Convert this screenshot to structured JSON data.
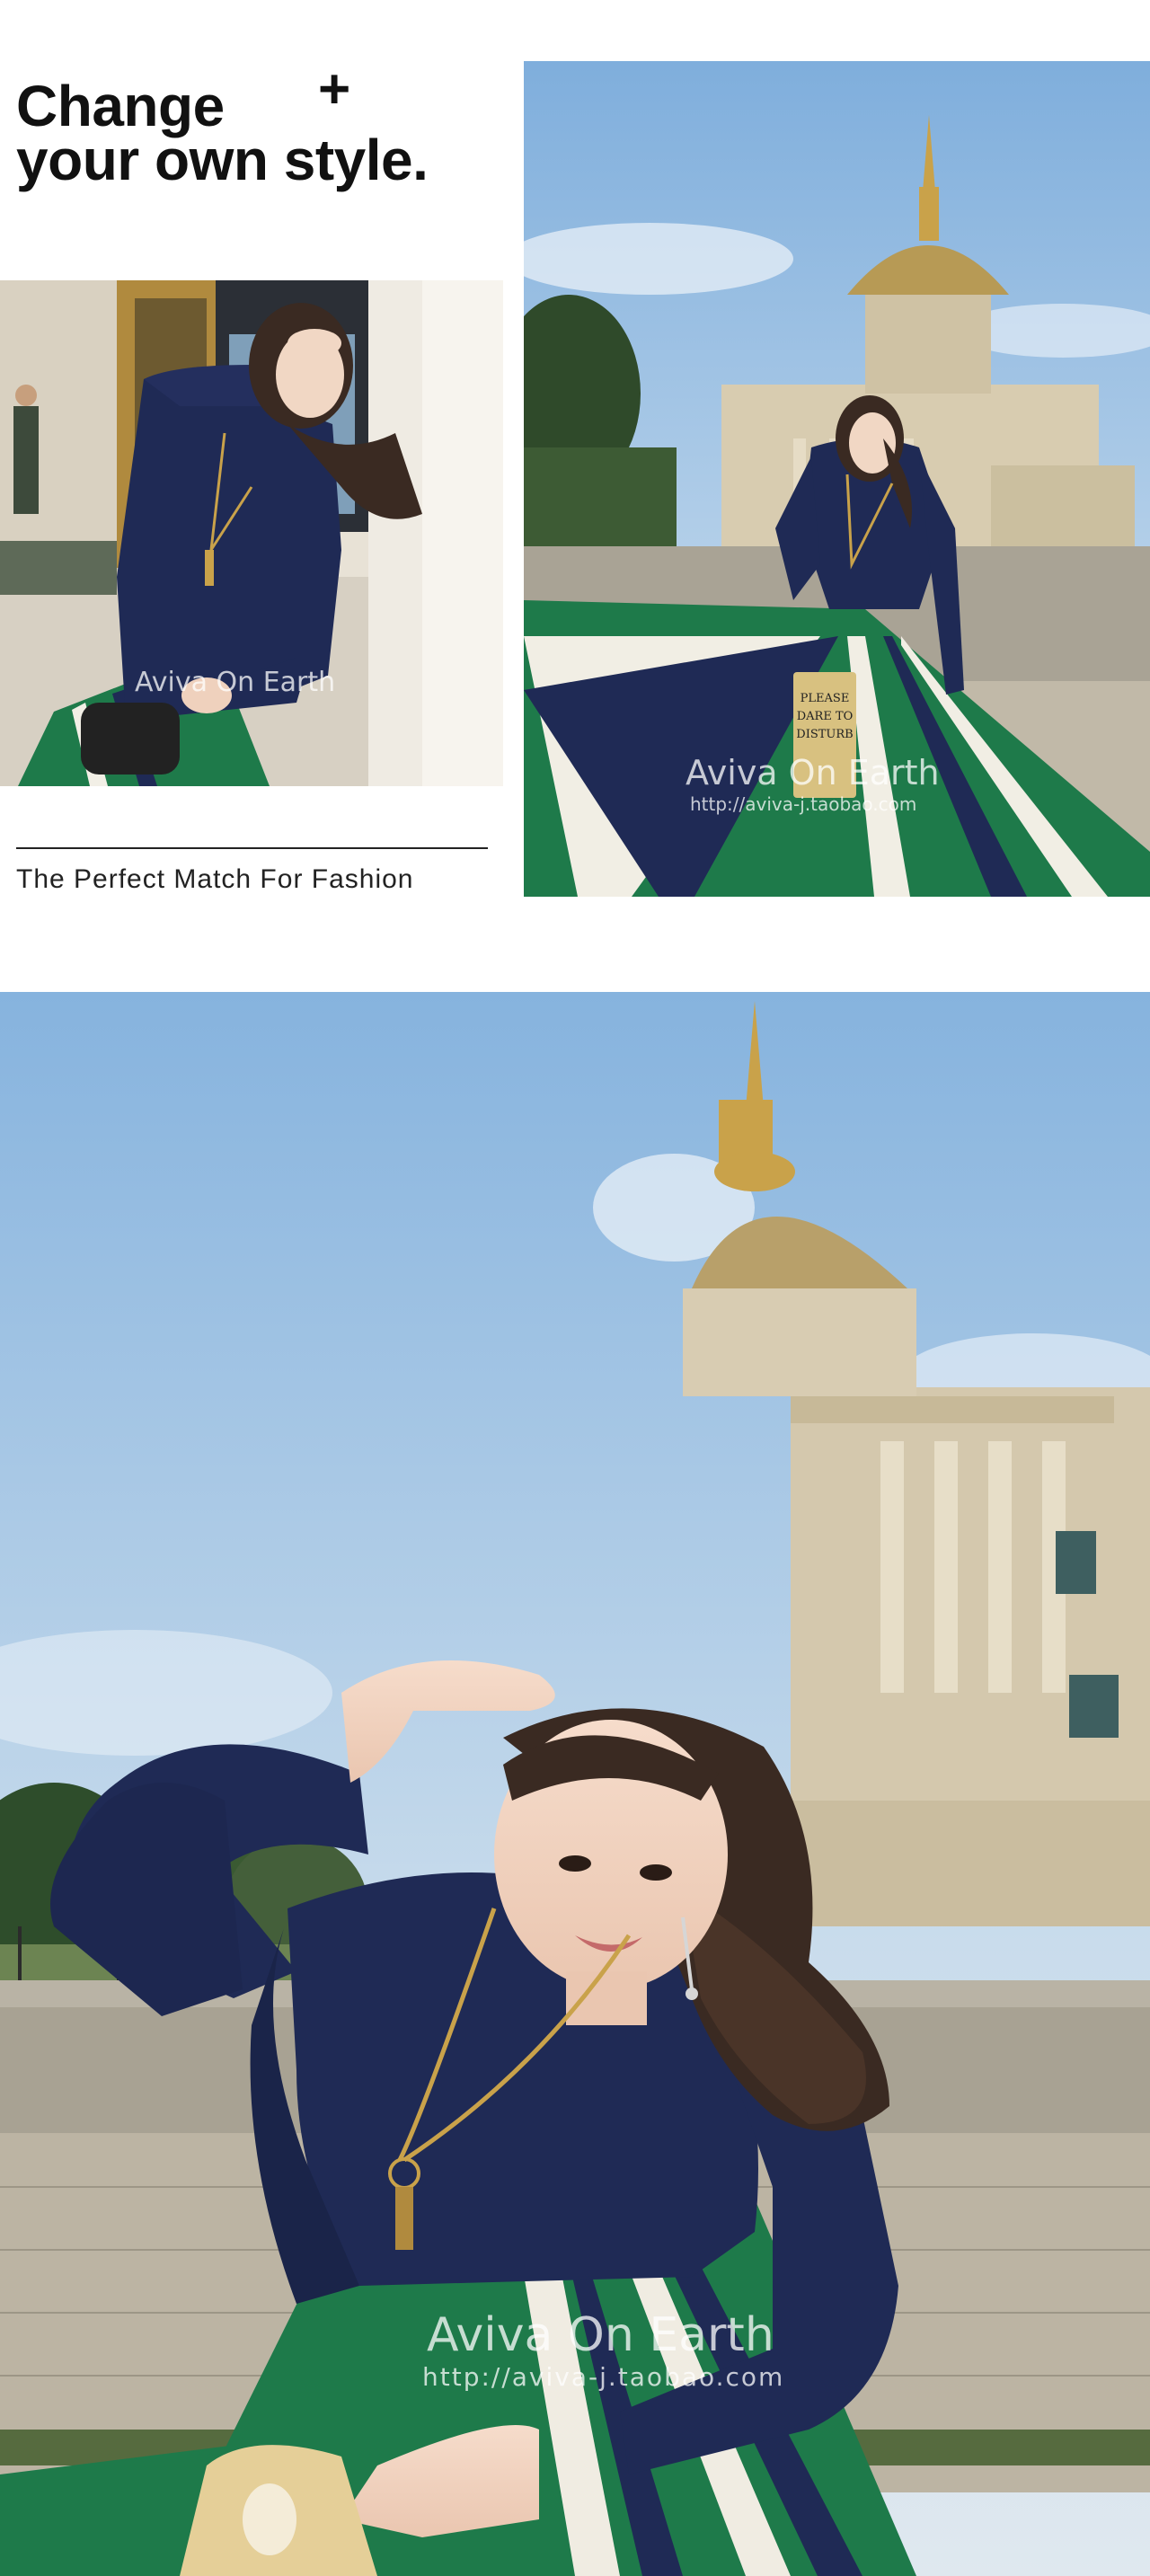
{
  "header": {
    "headline_line1": "Change",
    "headline_line2": "your own style.",
    "plus_symbol": "+",
    "tagline": "The Perfect Match For Fashion"
  },
  "photos": {
    "small_left": {
      "watermark": "Aviva On Earth"
    },
    "right_top": {
      "watermark": "Aviva On Earth",
      "watermark_url": "http://aviva-j.taobao.com",
      "bag_text": "PLEASE DARE TO DISTURB"
    },
    "bottom_large": {
      "watermark": "Aviva On Earth",
      "watermark_url": "http://aviva-j.taobao.com"
    }
  },
  "colors": {
    "sky": "#8fb6dc",
    "sweater": "#1f2a55",
    "skirt_green": "#1e7a4a",
    "stone": "#cfc6b4",
    "gold": "#c9a24a"
  }
}
